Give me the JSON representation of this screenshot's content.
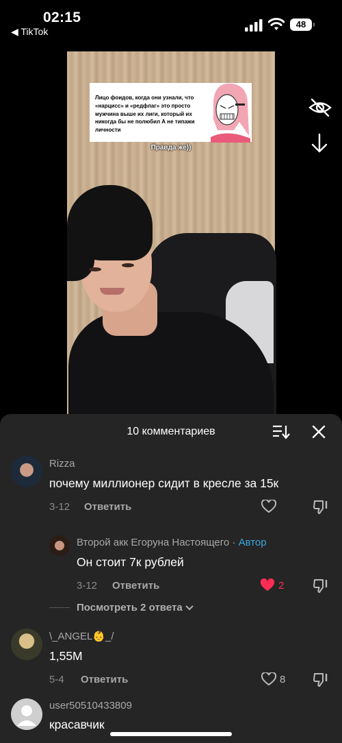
{
  "status_bar": {
    "time": "02:15",
    "back_app": "◀ TikTok",
    "battery": "48",
    "icons": [
      "signal-icon",
      "wifi-icon",
      "battery-icon"
    ]
  },
  "video": {
    "meme_text": "Лицо фоидов, когда они узнали, что «нарцисс» и «редфлаг» это просто мужчина выше их лиги, который их никогда бы не полюбил А не типажи личности",
    "caption": "Правда же))",
    "side_icons": [
      "eye-off-icon",
      "arrow-down-icon"
    ]
  },
  "comments_sheet": {
    "title": "10 комментариев",
    "comments": [
      {
        "user": "Rizza",
        "text": "почему миллионер сидит в кресле за 15к",
        "date": "3-12",
        "reply_label": "Ответить",
        "likes": ""
      },
      {
        "user": "Второй акк Егоруна Настоящего",
        "author_badge": "Автор",
        "separator": " · ",
        "text": "Он стоит 7к рублей",
        "date": "3-12",
        "reply_label": "Ответить",
        "likes": "2"
      },
      {
        "user": "\\_ANGEL👶_/",
        "text": "1,55M",
        "date": "5-4",
        "reply_label": "Ответить",
        "likes": "8"
      },
      {
        "user": "user50510433809",
        "text": "красавчик"
      }
    ],
    "view_replies": "Посмотреть 2 ответа"
  },
  "colors": {
    "sheet_bg": "#252525",
    "like_red": "#fe2c55",
    "author_blue": "#3aa7d9"
  }
}
